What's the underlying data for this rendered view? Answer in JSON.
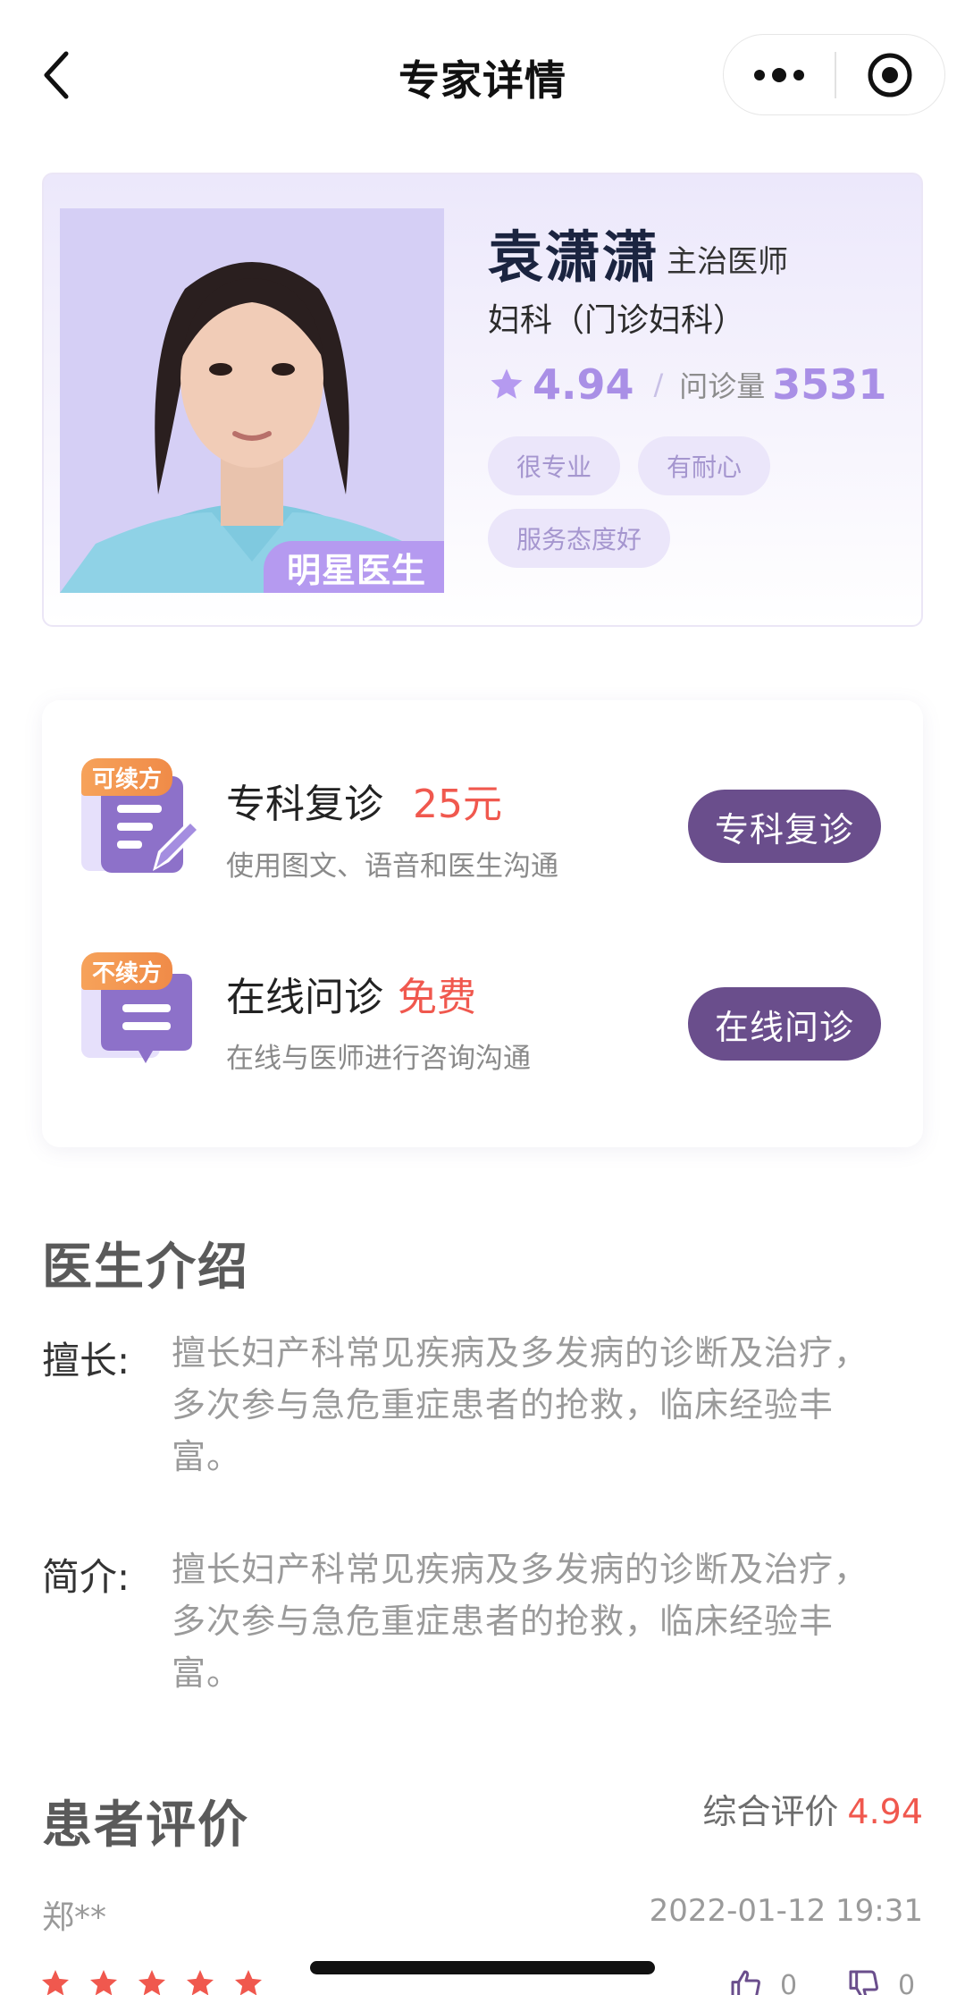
{
  "nav": {
    "title": "专家详情",
    "back_icon": "chevron-left",
    "more_icon": "more-dots",
    "close_icon": "target-circle"
  },
  "doctor": {
    "name": "袁潇潇",
    "title": "主治医师",
    "department": "妇科（门诊妇科）",
    "rating": "4.94",
    "rating_slash": "/",
    "consult_label": "问诊量",
    "consult_count": "3531",
    "star_badge": "明星医生",
    "tags": [
      "很专业",
      "有耐心",
      "服务态度好"
    ]
  },
  "services": [
    {
      "badge": "可续方",
      "name": "专科复诊",
      "price": "25元",
      "desc": "使用图文、语音和医生沟通",
      "button": "专科复诊",
      "icon": "document-edit-icon"
    },
    {
      "badge": "不续方",
      "name": "在线问诊",
      "price": "免费",
      "desc": "在线与医师进行咨询沟通",
      "button": "在线问诊",
      "icon": "chat-bubble-icon"
    }
  ],
  "intro": {
    "section_title": "医生介绍",
    "specialty_label": "擅长:",
    "specialty_text": "擅长妇产科常见疾病及多发病的诊断及治疗，多次参与急危重症患者的抢救，临床经验丰富。",
    "bio_label": "简介:",
    "bio_text": "擅长妇产科常见疾病及多发病的诊断及治疗，多次参与急危重症患者的抢救，临床经验丰富。"
  },
  "reviews": {
    "section_title": "患者评价",
    "overall_label": "综合评价",
    "overall_value": "4.94",
    "items": [
      {
        "reviewer": "郑**",
        "date": "2022-01-12 19:31",
        "stars": 5,
        "likes": "0",
        "dislikes": "0"
      }
    ]
  },
  "colors": {
    "accent_purple": "#6a4e8c",
    "light_purple": "#a98fe6",
    "price_red": "#f0584e",
    "badge_orange": "#f08b48"
  }
}
